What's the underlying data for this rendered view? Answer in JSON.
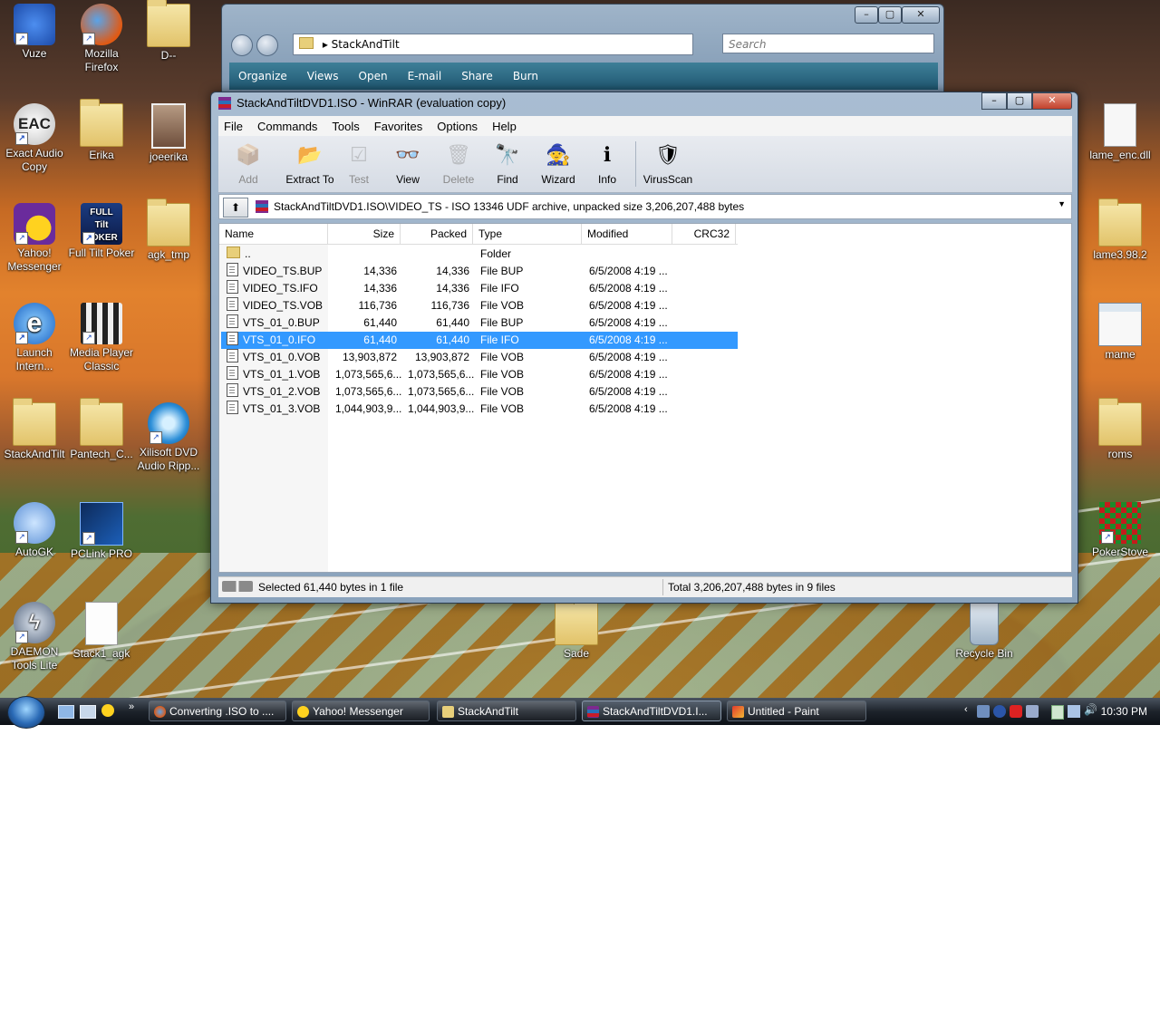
{
  "desktop": {
    "icons_left": [
      {
        "label": "Vuze",
        "icon": "frog-icon"
      },
      {
        "label": "Mozilla Firefox",
        "icon": "firefox-icon"
      },
      {
        "label": "D--",
        "icon": "folder-icon"
      },
      {
        "label": "Exact Audio Copy",
        "icon": "eac-icon"
      },
      {
        "label": "Erika",
        "icon": "folder-icon"
      },
      {
        "label": "joeerika",
        "icon": "photo-icon"
      },
      {
        "label": "Yahoo! Messenger",
        "icon": "yahoo-icon"
      },
      {
        "label": "Full Tilt Poker",
        "icon": "poker-icon"
      },
      {
        "label": "agk_tmp",
        "icon": "folder-icon"
      },
      {
        "label": "Launch Intern...",
        "icon": "ie-icon"
      },
      {
        "label": "Media Player Classic",
        "icon": "mpc-icon"
      },
      {
        "label": "StackAndTilt",
        "icon": "folder-icon"
      },
      {
        "label": "Pantech_C...",
        "icon": "folder-icon"
      },
      {
        "label": "Xilisoft DVD Audio Ripp...",
        "icon": "xilisoft-icon"
      },
      {
        "label": "AutoGK",
        "icon": "autogk-icon"
      },
      {
        "label": "PCLink PRO",
        "icon": "pclink-icon"
      },
      {
        "label": "DAEMON Tools Lite",
        "icon": "daemon-icon"
      },
      {
        "label": "Stack1_agk",
        "icon": "document-icon"
      },
      {
        "label": "Sade",
        "icon": "folder-icon"
      }
    ],
    "icons_right": [
      {
        "label": "lame_enc.dll",
        "icon": "dll-icon"
      },
      {
        "label": "lame3.98.2",
        "icon": "folder-icon"
      },
      {
        "label": "mame",
        "icon": "window-icon"
      },
      {
        "label": "roms",
        "icon": "folder-icon"
      },
      {
        "label": "PokerStove",
        "icon": "pokerstove-icon"
      },
      {
        "label": "Recycle Bin",
        "icon": "recycle-bin-icon"
      }
    ]
  },
  "explorer": {
    "address": "StackAndTilt",
    "search_placeholder": "Search",
    "commands": [
      "Organize",
      "Views",
      "Open",
      "E-mail",
      "Share",
      "Burn"
    ]
  },
  "winrar": {
    "title": "StackAndTiltDVD1.ISO - WinRAR (evaluation copy)",
    "menu": [
      "File",
      "Commands",
      "Tools",
      "Favorites",
      "Options",
      "Help"
    ],
    "toolbar": [
      {
        "label": "Add",
        "enabled": false
      },
      {
        "label": "Extract To",
        "enabled": true
      },
      {
        "label": "Test",
        "enabled": false
      },
      {
        "label": "View",
        "enabled": true
      },
      {
        "label": "Delete",
        "enabled": false
      },
      {
        "label": "Find",
        "enabled": true
      },
      {
        "label": "Wizard",
        "enabled": true
      },
      {
        "label": "Info",
        "enabled": true
      },
      {
        "label": "VirusScan",
        "enabled": true
      }
    ],
    "path": "StackAndTiltDVD1.ISO\\VIDEO_TS - ISO 13346 UDF archive, unpacked size 3,206,207,488 bytes",
    "columns": [
      "Name",
      "Size",
      "Packed",
      "Type",
      "Modified",
      "CRC32"
    ],
    "files": [
      {
        "name": "..",
        "size": "",
        "packed": "",
        "type": "Folder",
        "modified": "",
        "crc": "",
        "selected": false
      },
      {
        "name": "VIDEO_TS.BUP",
        "size": "14,336",
        "packed": "14,336",
        "type": "File BUP",
        "modified": "6/5/2008 4:19 ...",
        "crc": "",
        "selected": false
      },
      {
        "name": "VIDEO_TS.IFO",
        "size": "14,336",
        "packed": "14,336",
        "type": "File IFO",
        "modified": "6/5/2008 4:19 ...",
        "crc": "",
        "selected": false
      },
      {
        "name": "VIDEO_TS.VOB",
        "size": "116,736",
        "packed": "116,736",
        "type": "File VOB",
        "modified": "6/5/2008 4:19 ...",
        "crc": "",
        "selected": false
      },
      {
        "name": "VTS_01_0.BUP",
        "size": "61,440",
        "packed": "61,440",
        "type": "File BUP",
        "modified": "6/5/2008 4:19 ...",
        "crc": "",
        "selected": false
      },
      {
        "name": "VTS_01_0.IFO",
        "size": "61,440",
        "packed": "61,440",
        "type": "File IFO",
        "modified": "6/5/2008 4:19 ...",
        "crc": "",
        "selected": true
      },
      {
        "name": "VTS_01_0.VOB",
        "size": "13,903,872",
        "packed": "13,903,872",
        "type": "File VOB",
        "modified": "6/5/2008 4:19 ...",
        "crc": "",
        "selected": false
      },
      {
        "name": "VTS_01_1.VOB",
        "size": "1,073,565,6...",
        "packed": "1,073,565,6...",
        "type": "File VOB",
        "modified": "6/5/2008 4:19 ...",
        "crc": "",
        "selected": false
      },
      {
        "name": "VTS_01_2.VOB",
        "size": "1,073,565,6...",
        "packed": "1,073,565,6...",
        "type": "File VOB",
        "modified": "6/5/2008 4:19 ...",
        "crc": "",
        "selected": false
      },
      {
        "name": "VTS_01_3.VOB",
        "size": "1,044,903,9...",
        "packed": "1,044,903,9...",
        "type": "File VOB",
        "modified": "6/5/2008 4:19 ...",
        "crc": "",
        "selected": false
      }
    ],
    "status_left": "Selected 61,440 bytes in 1 file",
    "status_right": "Total 3,206,207,488 bytes in 9 files"
  },
  "taskbar": {
    "buttons": [
      {
        "label": "Converting .ISO to ....",
        "active": false,
        "icon": "firefox-icon"
      },
      {
        "label": "Yahoo! Messenger",
        "active": false,
        "icon": "yahoo-icon"
      },
      {
        "label": "StackAndTilt",
        "active": false,
        "icon": "folder-icon"
      },
      {
        "label": "StackAndTiltDVD1.I...",
        "active": true,
        "icon": "winrar-icon"
      },
      {
        "label": "Untitled - Paint",
        "active": false,
        "icon": "paint-icon"
      }
    ],
    "clock": "10:30 PM"
  },
  "colors": {
    "selection": "#3399ff",
    "taskbar": "#1d232b"
  }
}
